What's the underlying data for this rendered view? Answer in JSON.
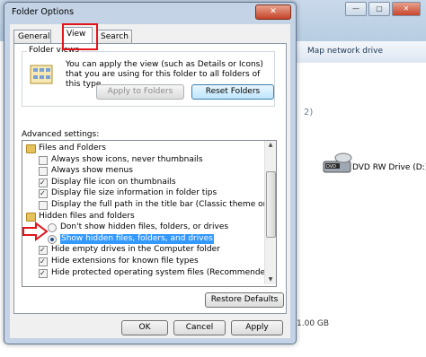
{
  "background": {
    "toolbar_item": "Map network drive",
    "section_marker": "2)",
    "drive_label": "DVD RW Drive (D:)",
    "size_fragment": "1.00 GB",
    "window_buttons": [
      "—",
      "▢",
      "✕"
    ]
  },
  "dialog": {
    "title": "Folder Options",
    "close_glyph": "✕",
    "tabs": [
      "General",
      "View",
      "Search"
    ],
    "folder_views": {
      "heading": "Folder views",
      "description": "You can apply the view (such as Details or Icons) that you are using for this folder to all folders of this type.",
      "apply_button": "Apply to Folders",
      "reset_button": "Reset Folders"
    },
    "advanced_label": "Advanced settings:",
    "tree": [
      {
        "type": "folder",
        "text": "Files and Folders"
      },
      {
        "type": "checkbox",
        "checked": false,
        "text": "Always show icons, never thumbnails"
      },
      {
        "type": "checkbox",
        "checked": false,
        "text": "Always show menus"
      },
      {
        "type": "checkbox",
        "checked": true,
        "text": "Display file icon on thumbnails"
      },
      {
        "type": "checkbox",
        "checked": true,
        "text": "Display file size information in folder tips"
      },
      {
        "type": "checkbox",
        "checked": false,
        "text": "Display the full path in the title bar (Classic theme only)"
      },
      {
        "type": "folder",
        "text": "Hidden files and folders"
      },
      {
        "type": "radio",
        "checked": false,
        "text": "Don't show hidden files, folders, or drives"
      },
      {
        "type": "radio",
        "checked": true,
        "text": "Show hidden files, folders, and drives",
        "selected": true
      },
      {
        "type": "checkbox",
        "checked": true,
        "text": "Hide empty drives in the Computer folder"
      },
      {
        "type": "checkbox",
        "checked": true,
        "text": "Hide extensions for known file types"
      },
      {
        "type": "checkbox",
        "checked": true,
        "text": "Hide protected operating system files (Recommended)"
      }
    ],
    "restore_button": "Restore Defaults",
    "ok_button": "OK",
    "cancel_button": "Cancel",
    "apply_button": "Apply"
  },
  "colors": {
    "annotation_red": "#e0161b",
    "selection_blue": "#3399ff"
  }
}
